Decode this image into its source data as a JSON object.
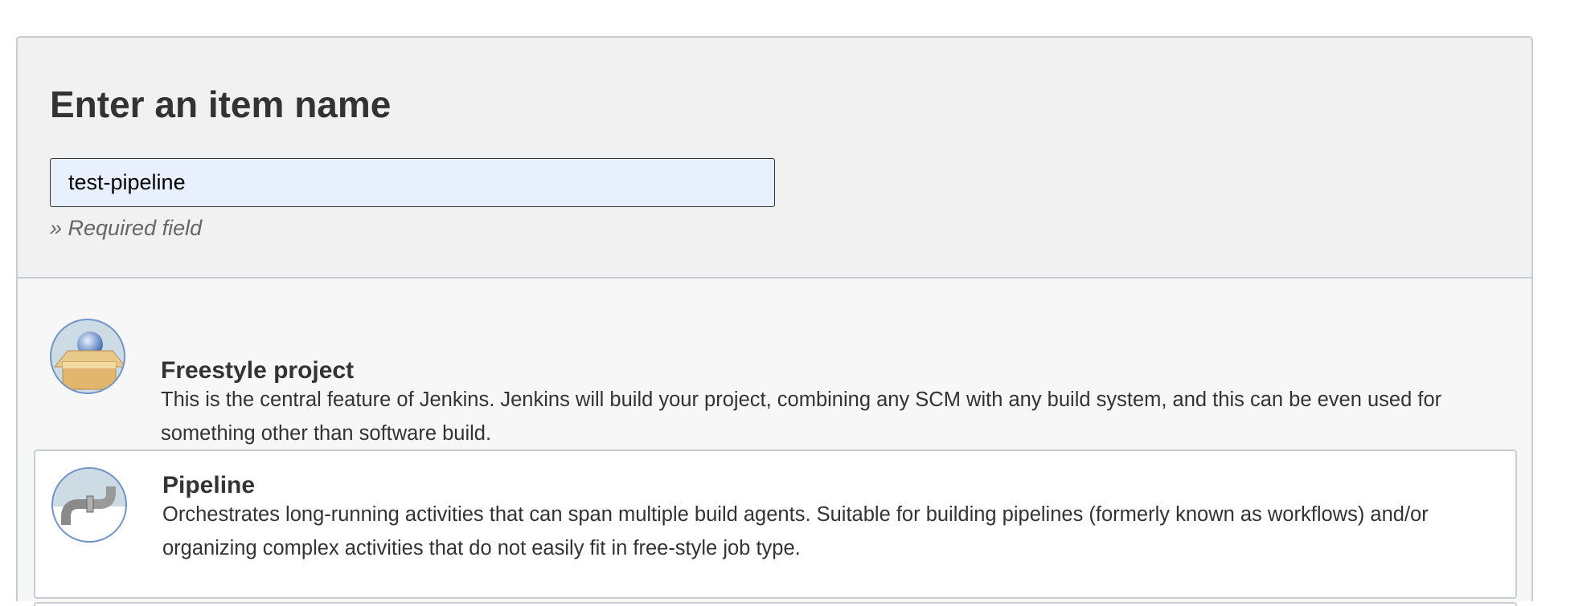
{
  "header": {
    "title": "Enter an item name",
    "name_value": "test-pipeline",
    "required_hint": "» Required field"
  },
  "items": [
    {
      "icon": "freestyle-box-icon",
      "title": "Freestyle project",
      "description": "This is the central feature of Jenkins. Jenkins will build your project, combining any SCM with any build system, and this can be even used for something other than software build."
    },
    {
      "icon": "pipeline-pipe-icon",
      "title": "Pipeline",
      "description": "Orchestrates long-running activities that can span multiple build agents. Suitable for building pipelines (formerly known as workflows) and/or organizing complex activities that do not easily fit in free-style job type."
    }
  ],
  "colors": {
    "panel_border": "#c8cdd3",
    "input_bg": "#e8f0fe",
    "icon_ring": "#6f93c9"
  }
}
